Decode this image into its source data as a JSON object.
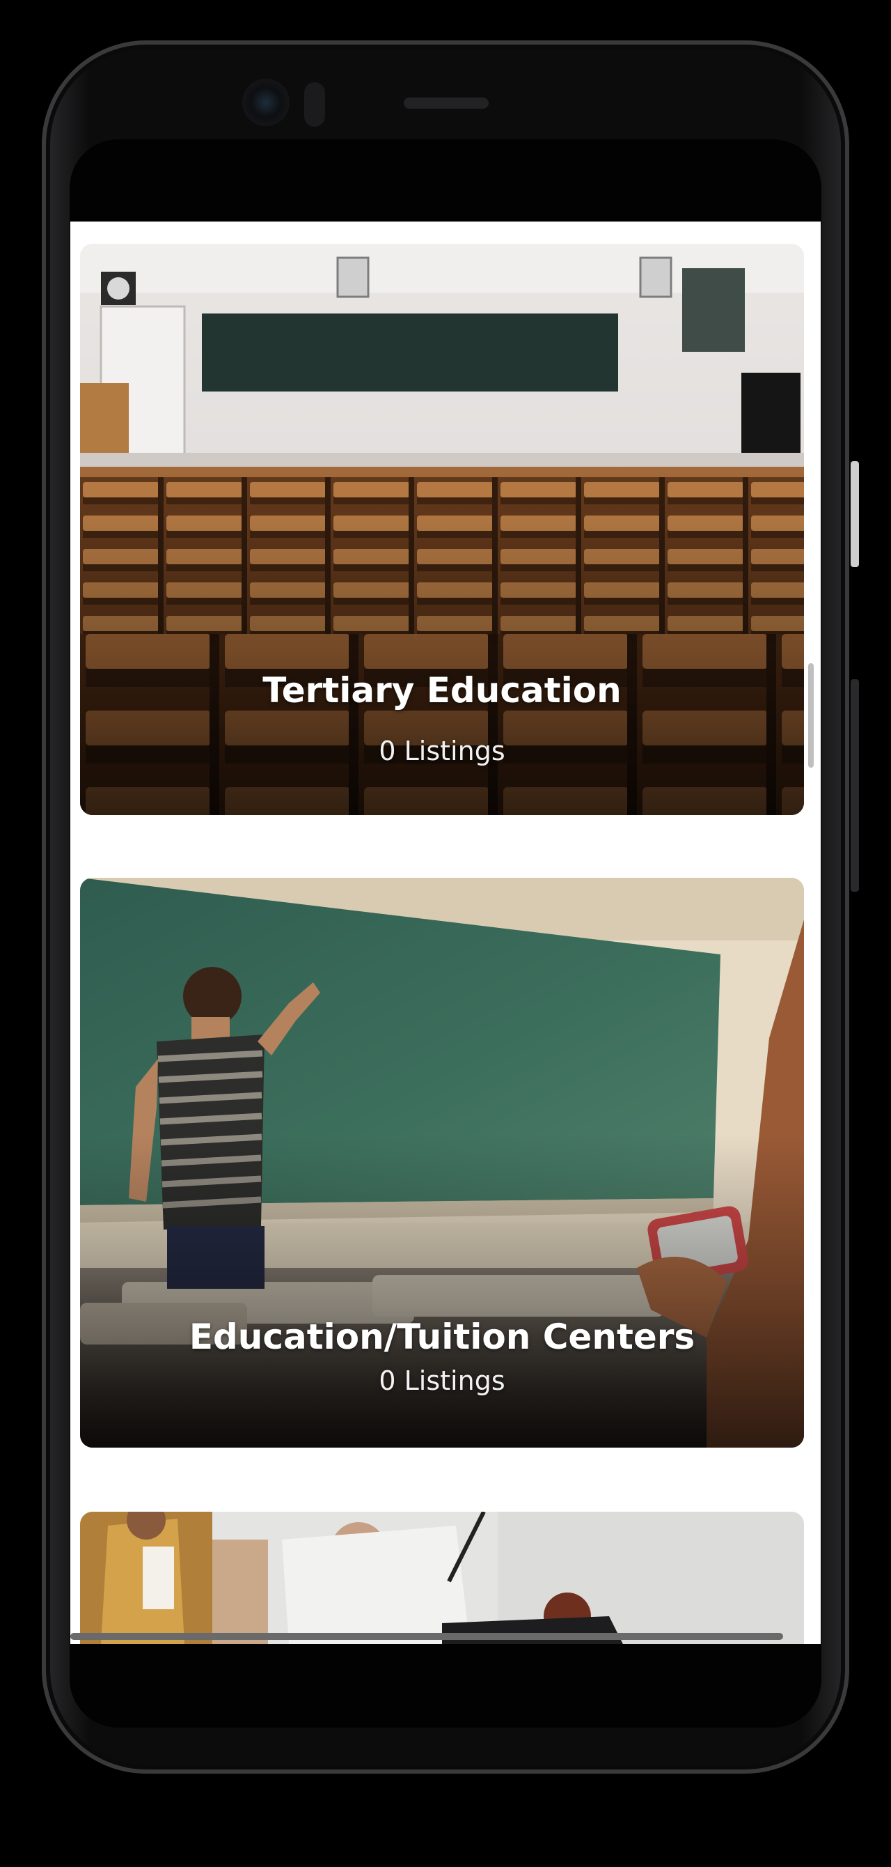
{
  "cards": [
    {
      "title": "Tertiary Education",
      "listings": "0 Listings"
    },
    {
      "title": "Education/Tuition Centers",
      "listings": "0 Listings"
    },
    {
      "title": "",
      "listings": ""
    }
  ],
  "colors": {
    "screen_background": "#ffffff",
    "title_text": "#ffffff",
    "device_frame": "#0c0c0d"
  }
}
